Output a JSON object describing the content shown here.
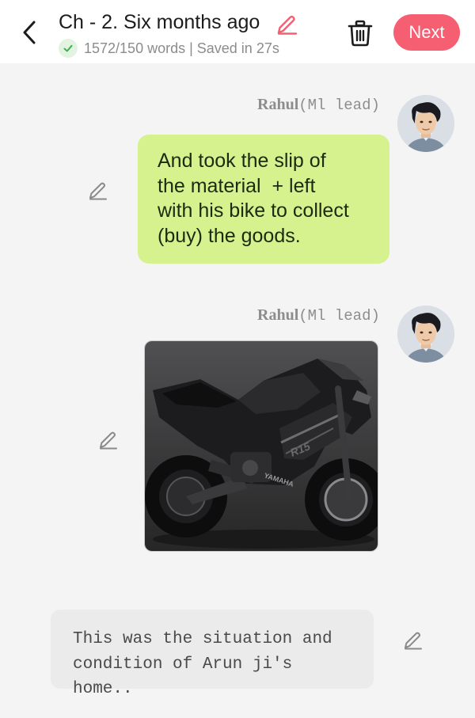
{
  "header": {
    "chapter_title": "Ch - 2. Six months ago",
    "status_text": "1572/150 words | Saved in 27s",
    "next_label": "Next"
  },
  "messages": [
    {
      "type": "text",
      "speaker_name": "Rahul",
      "speaker_role": "(Ml lead)",
      "text_lines": [
        "And took the slip of",
        "the material  + left",
        "with his bike to collect",
        "(buy) the goods."
      ]
    },
    {
      "type": "image",
      "speaker_name": "Rahul",
      "speaker_role": "(Ml lead)",
      "image_logo": "YAMAHA",
      "image_badge": "R15"
    },
    {
      "type": "narration",
      "text_lines": [
        "This was the situation and",
        "condition of Arun ji's home.."
      ]
    }
  ],
  "colors": {
    "accent": "#f65e72",
    "green_bubble": "#d6f28e",
    "narration_bubble": "#ebebeb",
    "background": "#f4f4f4",
    "saved_check": "#3bb54a"
  },
  "icons": [
    "back-arrow-icon",
    "pencil-icon",
    "check-icon",
    "trash-icon"
  ]
}
